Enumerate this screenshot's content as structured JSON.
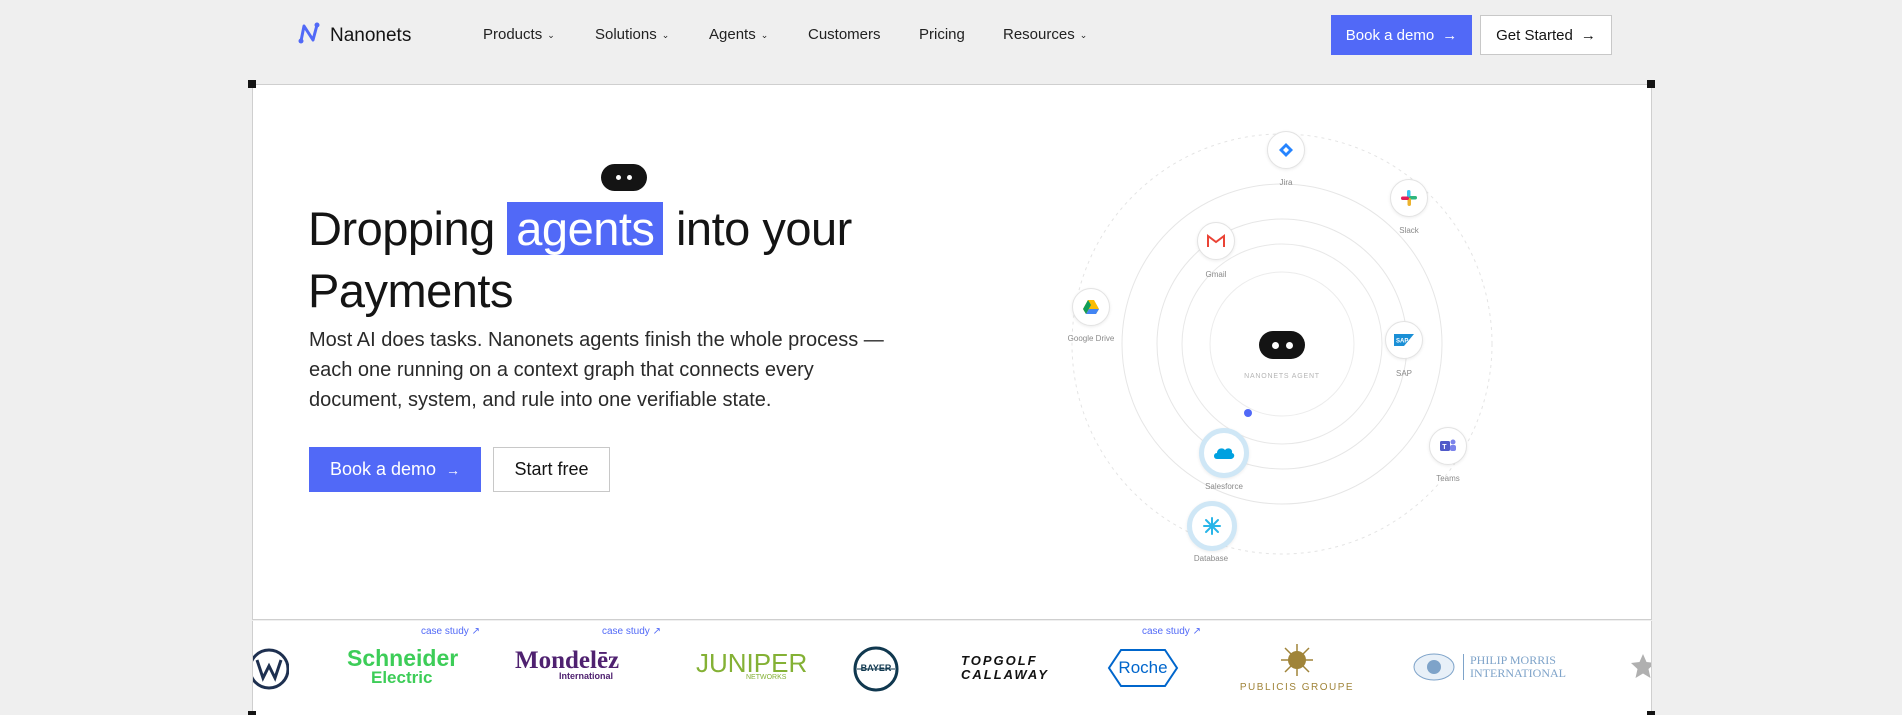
{
  "nav": {
    "brand": "Nanonets",
    "menu": [
      {
        "label": "Products",
        "has_dropdown": true
      },
      {
        "label": "Solutions",
        "has_dropdown": true
      },
      {
        "label": "Agents",
        "has_dropdown": true
      },
      {
        "label": "Customers",
        "has_dropdown": false
      },
      {
        "label": "Pricing",
        "has_dropdown": false
      },
      {
        "label": "Resources",
        "has_dropdown": true
      }
    ],
    "book_demo": "Book a demo",
    "get_started": "Get Started",
    "arrow": "→"
  },
  "hero": {
    "title_before": "Dropping",
    "title_highlight": "agents",
    "title_after": "into your",
    "title_line2": "Payments",
    "subtitle": "Most AI does tasks. Nanonets agents finish the whole process — each one running on a context graph that connects every document, system, and rule into one verifiable state.",
    "book_demo": "Book a demo",
    "start_free": "Start free",
    "arrow": "→"
  },
  "orbit": {
    "center_label": "NANONETS AGENT",
    "integrations": [
      {
        "name": "Jira",
        "icon": "jira-icon"
      },
      {
        "name": "Slack",
        "icon": "slack-icon"
      },
      {
        "name": "Gmail",
        "icon": "gmail-icon"
      },
      {
        "name": "Google Drive",
        "icon": "google-drive-icon"
      },
      {
        "name": "SAP",
        "icon": "sap-icon"
      },
      {
        "name": "Teams",
        "icon": "teams-icon"
      },
      {
        "name": "Salesforce",
        "icon": "salesforce-icon"
      },
      {
        "name": "Database",
        "icon": "database-icon"
      }
    ]
  },
  "logos": {
    "case_study": "case study ↗",
    "brands": [
      {
        "name": "Schneider",
        "name2": "Electric",
        "color": "#3dcd58"
      },
      {
        "name": "Mondelēz",
        "name2": "International",
        "color": "#4f2170"
      },
      {
        "name": "JUNIPER",
        "name2": "NETWORKS",
        "color": "#84b135"
      },
      {
        "name": "BAYER",
        "color": "#10384f"
      },
      {
        "name": "TOPGOLF",
        "name2": "CALLAWAY",
        "color": "#111111"
      },
      {
        "name": "Roche",
        "color": "#0066cc"
      },
      {
        "name": "PUBLICIS GROUPE",
        "color": "#a08439"
      },
      {
        "name": "PHILIP MORRIS",
        "name2": "INTERNATIONAL",
        "color": "#7ea3c9"
      }
    ]
  },
  "colors": {
    "accent": "#5169f7",
    "background": "#efefef"
  }
}
